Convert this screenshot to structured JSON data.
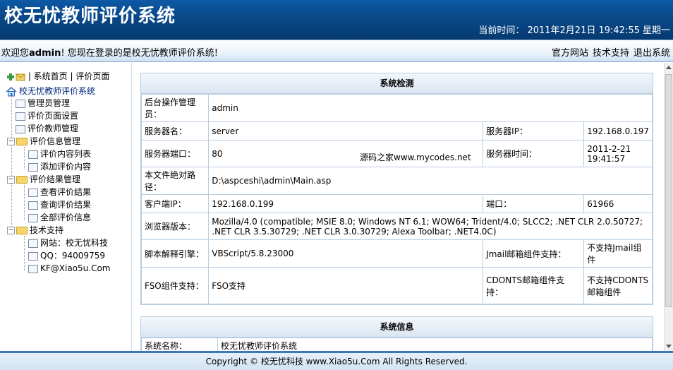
{
  "header": {
    "title": "校无忧教师评价系统",
    "clock": "当前时间： 2011年2月21日 19:42:55 星期一"
  },
  "welcome": {
    "prefix": "欢迎您",
    "user": "admin",
    "suffix": "! 您现在登录的是校无忧教师评价系统!",
    "links": [
      "官方网站",
      "技术支持",
      "退出系统"
    ]
  },
  "sidebar": {
    "topnav": "| 系统首页 | 评价页面",
    "root": "校无忧教师评价系统",
    "items": {
      "admin_mgmt": "管理员管理",
      "eval_page_settings": "评价页面设置",
      "eval_teacher_mgmt": "评价教师管理",
      "eval_info_mgmt": "评价信息管理",
      "eval_content_list": "评价内容列表",
      "add_eval_content": "添加评价内容",
      "eval_result_mgmt": "评价结果管理",
      "view_results": "查看评价结果",
      "query_results": "查询评价结果",
      "all_info": "全部评价信息",
      "tech_support": "技术支持",
      "website": "网站：校无忧科技",
      "qq": "QQ：94009759",
      "email": "KF@Xiao5u.Com"
    }
  },
  "main": {
    "panel1_title": "系统检测",
    "watermark": "源码之家www.mycodes.net",
    "rows": {
      "admin_label": "后台操作管理员：",
      "admin_value": "admin",
      "server_name_label": "服务器名：",
      "server_name_value": "server",
      "server_ip_label": "服务器IP：",
      "server_ip_value": "192.168.0.197",
      "server_port_label": "服务器端口：",
      "server_port_value": "80",
      "server_time_label": "服务器时间：",
      "server_time_value": "2011-2-21 19:41:57",
      "path_label": "本文件绝对路径：",
      "path_value": "D:\\aspceshi\\admin\\Main.asp",
      "client_ip_label": "客户端IP：",
      "client_ip_value": "192.168.0.199",
      "port_label": "端口：",
      "port_value": "61966",
      "browser_label": "浏览器版本：",
      "browser_value": "Mozilla/4.0 (compatible; MSIE 8.0; Windows NT 6.1; WOW64; Trident/4.0; SLCC2; .NET CLR 2.0.50727; .NET CLR 3.5.30729; .NET CLR 3.0.30729; Alexa Toolbar; .NET4.0C)",
      "script_label": "脚本解释引擎：",
      "script_value": "VBScript/5.8.23000",
      "jmail_label": "Jmail邮箱组件支持：",
      "jmail_value": "不支持Jmail组件",
      "fso_label": "FSO组件支持：",
      "fso_value": "FSO支持",
      "cdonts_label": "CDONTS邮箱组件支持：",
      "cdonts_value": "不支持CDONTS邮箱组件"
    },
    "panel2_title": "系统信息",
    "sysname_label": "系统名称：",
    "sysname_value": "校无忧教师评价系统"
  },
  "footer": {
    "text": "Copyright © 校无忧科技  www.Xiao5u.Com All Rights Reserved."
  }
}
